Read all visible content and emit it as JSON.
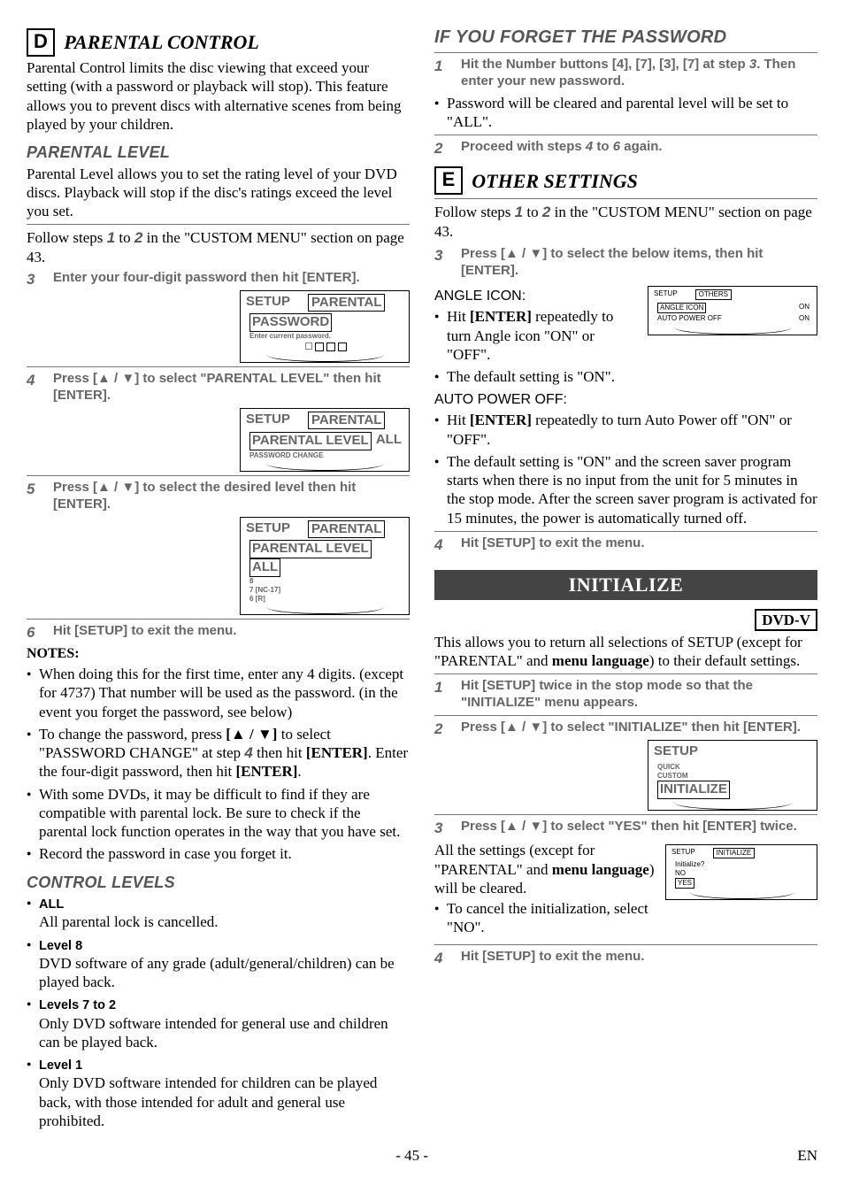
{
  "parental": {
    "letter": "D",
    "title": "PARENTAL CONTROL",
    "intro": "Parental Control limits the disc viewing that exceed your setting (with a password or playback will stop). This feature allows you to prevent discs with alternative scenes from being played by your children.",
    "level_head": "PARENTAL LEVEL",
    "level_intro": "Parental Level allows you to set the rating level of your DVD discs. Playback will stop if the disc's ratings exceed the level you set.",
    "follow": "Follow steps ",
    "follow_mid": " to ",
    "follow_tail": " in the \"CUSTOM MENU\" section on page 43.",
    "s1": "1",
    "s2": "2",
    "step3": "Enter your four-digit password then hit [ENTER].",
    "step4": "Press [▲ / ▼] to select \"PARENTAL LEVEL\" then hit [ENTER].",
    "step5": "Press [▲ / ▼] to select the desired level then hit [ENTER].",
    "step6": "Hit [SETUP] to exit the menu.",
    "n3": "3",
    "n4": "4",
    "n5": "5",
    "n6": "6",
    "notes_head": "NOTES:",
    "notes": [
      "When doing this for the first time, enter any 4 digits. (except for 4737) That number will be used as the password. (in the event you forget the password, see below)",
      "To change the password, press [▲ / ▼] to select \"PASSWORD CHANGE\" at step 4 then hit [ENTER]. Enter the four-digit password, then hit [ENTER].",
      "With some DVDs, it may be difficult to find if they are compatible with parental lock. Be sure to check if the parental lock function operates in the way that you have set.",
      "Record the password in case you forget it."
    ],
    "control_head": "CONTROL LEVELS",
    "ctrl": [
      {
        "t": "ALL",
        "d": "All parental lock is cancelled."
      },
      {
        "t": "Level 8",
        "d": "DVD software of any grade (adult/general/children) can be played back."
      },
      {
        "t": "Levels 7 to 2",
        "d": "Only DVD software intended for general use and children can be played back."
      },
      {
        "t": "Level 1",
        "d": "Only DVD software intended for children can be played back, with those intended for adult and general use prohibited."
      }
    ],
    "osd1": {
      "tab1": "SETUP",
      "tab2": "PARENTAL",
      "row1": "PASSWORD",
      "row2": "Enter current password."
    },
    "osd2": {
      "tab1": "SETUP",
      "tab2": "PARENTAL",
      "row1": "PARENTAL LEVEL",
      "row2": "PASSWORD CHANGE",
      "val": "ALL"
    },
    "osd3": {
      "tab1": "SETUP",
      "tab2": "PARENTAL",
      "head": "PARENTAL LEVEL",
      "rows": [
        "ALL",
        "8",
        "7 [NC-17]",
        "6 [R]"
      ]
    }
  },
  "forget": {
    "title": "IF YOU FORGET THE PASSWORD",
    "step1": "Hit the Number buttons [4], [7], [3], [7] at step 3. Then enter your new password.",
    "n1": "1",
    "bullet1": "Password will be cleared and parental level will be set to \"ALL\".",
    "step2": "Proceed with steps 4 to 6 again.",
    "n2": "2"
  },
  "other": {
    "letter": "E",
    "title": "OTHER SETTINGS",
    "follow": "Follow steps ",
    "follow_mid": " to ",
    "follow_tail": " in the \"CUSTOM MENU\" section on page 43.",
    "s1": "1",
    "s2": "2",
    "step3": "Press [▲ / ▼] to select the below items, then hit [ENTER].",
    "n3": "3",
    "osd": {
      "tab1": "SETUP",
      "tab2": "OTHERS",
      "r1l": "ANGLE ICON",
      "r1r": "ON",
      "r2l": "AUTO POWER OFF",
      "r2r": "ON"
    },
    "angle_head": "ANGLE ICON:",
    "angle_b1": "Hit [ENTER] repeatedly to turn Angle icon \"ON\" or \"OFF\".",
    "angle_b2": "The default setting is \"ON\".",
    "apo_head": "AUTO POWER OFF:",
    "apo_b1": "Hit [ENTER] repeatedly to turn Auto Power off \"ON\" or \"OFF\".",
    "apo_b2": "The default setting is \"ON\" and the screen saver program starts when there is no input from the unit for 5 minutes in the stop mode. After the screen saver program is activated for 15 minutes, the power is automatically turned off.",
    "step4": "Hit [SETUP] to exit the menu.",
    "n4": "4"
  },
  "init": {
    "banner": "INITIALIZE",
    "dvdv": "DVD-V",
    "intro": "This allows you to return all selections of SETUP (except for \"PARENTAL\" and menu language) to their default settings.",
    "step1": "Hit [SETUP] twice in the stop mode so that the \"INITIALIZE\" menu appears.",
    "step2": "Press [▲ / ▼] to select \"INITIALIZE\" then hit [ENTER].",
    "step3": "Press [▲ / ▼] to select \"YES\" then hit [ENTER] twice.",
    "n1": "1",
    "n2": "2",
    "n3": "3",
    "n4": "4",
    "res_text": "All the settings (except for \"PARENTAL\" and menu language) will be cleared.",
    "res_bullet": "To cancel the initialization, select \"NO\".",
    "step4": "Hit [SETUP] to exit the menu.",
    "osd1": {
      "tab1": "SETUP",
      "rows": [
        "QUICK",
        "CUSTOM",
        "INITIALIZE"
      ]
    },
    "osd2": {
      "tab1": "SETUP",
      "tab2": "INITIALIZE",
      "q": "Initialize?",
      "rows": [
        "NO",
        "YES"
      ]
    }
  },
  "footer": {
    "page": "- 45 -",
    "en": "EN"
  }
}
